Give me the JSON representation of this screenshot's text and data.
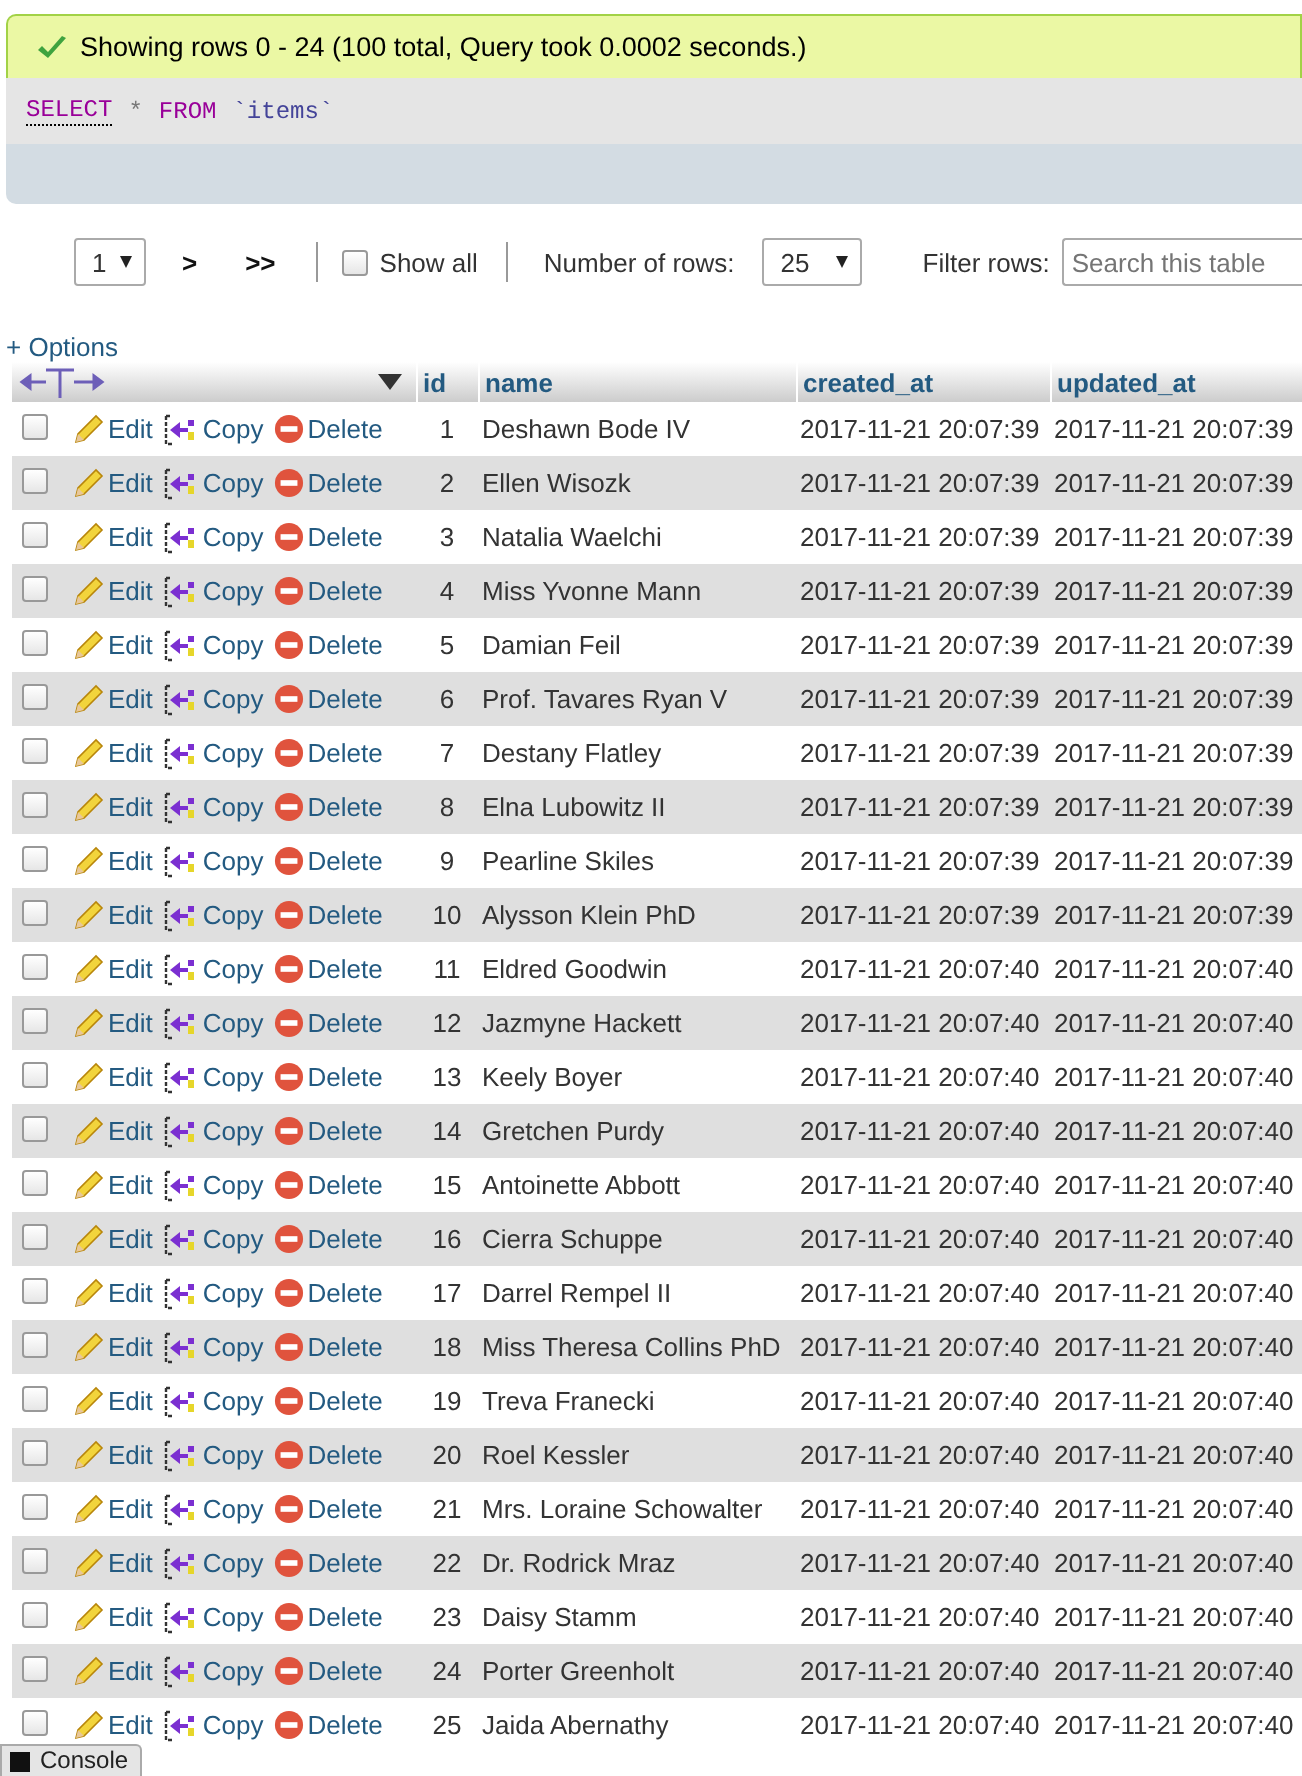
{
  "message": {
    "text": "Showing rows 0 - 24 (100 total, Query took 0.0002 seconds.)"
  },
  "sql": [
    {
      "kind": "keyword",
      "text": "SELECT",
      "link": true
    },
    {
      "kind": "operator",
      "text": "*",
      "link": false
    },
    {
      "kind": "keyword",
      "text": "FROM",
      "link": false
    },
    {
      "kind": "identifier",
      "text": "`items`",
      "link": false
    }
  ],
  "navigation": {
    "page": "1",
    "next": ">",
    "last": ">>",
    "show_all": {
      "label": "Show all",
      "checked": false
    },
    "rows_label": "Number of rows:",
    "rows_value": "25",
    "filter_label": "Filter rows:",
    "filter_placeholder": "Search this table"
  },
  "options_link": "+ Options",
  "columns": [
    "id",
    "name",
    "created_at",
    "updated_at"
  ],
  "rows": [
    {
      "checked": false,
      "edit": "Edit",
      "copy": "Copy",
      "delete": "Delete",
      "id": "1",
      "name": "Deshawn Bode IV",
      "created_at": "2017-11-21 20:07:39",
      "updated_at": "2017-11-21 20:07:39"
    },
    {
      "checked": false,
      "edit": "Edit",
      "copy": "Copy",
      "delete": "Delete",
      "id": "2",
      "name": "Ellen Wisozk",
      "created_at": "2017-11-21 20:07:39",
      "updated_at": "2017-11-21 20:07:39"
    },
    {
      "checked": false,
      "edit": "Edit",
      "copy": "Copy",
      "delete": "Delete",
      "id": "3",
      "name": "Natalia Waelchi",
      "created_at": "2017-11-21 20:07:39",
      "updated_at": "2017-11-21 20:07:39"
    },
    {
      "checked": false,
      "edit": "Edit",
      "copy": "Copy",
      "delete": "Delete",
      "id": "4",
      "name": "Miss Yvonne Mann",
      "created_at": "2017-11-21 20:07:39",
      "updated_at": "2017-11-21 20:07:39"
    },
    {
      "checked": false,
      "edit": "Edit",
      "copy": "Copy",
      "delete": "Delete",
      "id": "5",
      "name": "Damian Feil",
      "created_at": "2017-11-21 20:07:39",
      "updated_at": "2017-11-21 20:07:39"
    },
    {
      "checked": false,
      "edit": "Edit",
      "copy": "Copy",
      "delete": "Delete",
      "id": "6",
      "name": "Prof. Tavares Ryan V",
      "created_at": "2017-11-21 20:07:39",
      "updated_at": "2017-11-21 20:07:39"
    },
    {
      "checked": false,
      "edit": "Edit",
      "copy": "Copy",
      "delete": "Delete",
      "id": "7",
      "name": "Destany Flatley",
      "created_at": "2017-11-21 20:07:39",
      "updated_at": "2017-11-21 20:07:39"
    },
    {
      "checked": false,
      "edit": "Edit",
      "copy": "Copy",
      "delete": "Delete",
      "id": "8",
      "name": "Elna Lubowitz II",
      "created_at": "2017-11-21 20:07:39",
      "updated_at": "2017-11-21 20:07:39"
    },
    {
      "checked": false,
      "edit": "Edit",
      "copy": "Copy",
      "delete": "Delete",
      "id": "9",
      "name": "Pearline Skiles",
      "created_at": "2017-11-21 20:07:39",
      "updated_at": "2017-11-21 20:07:39"
    },
    {
      "checked": false,
      "edit": "Edit",
      "copy": "Copy",
      "delete": "Delete",
      "id": "10",
      "name": "Alysson Klein PhD",
      "created_at": "2017-11-21 20:07:39",
      "updated_at": "2017-11-21 20:07:39"
    },
    {
      "checked": false,
      "edit": "Edit",
      "copy": "Copy",
      "delete": "Delete",
      "id": "11",
      "name": "Eldred Goodwin",
      "created_at": "2017-11-21 20:07:40",
      "updated_at": "2017-11-21 20:07:40"
    },
    {
      "checked": false,
      "edit": "Edit",
      "copy": "Copy",
      "delete": "Delete",
      "id": "12",
      "name": "Jazmyne Hackett",
      "created_at": "2017-11-21 20:07:40",
      "updated_at": "2017-11-21 20:07:40"
    },
    {
      "checked": false,
      "edit": "Edit",
      "copy": "Copy",
      "delete": "Delete",
      "id": "13",
      "name": "Keely Boyer",
      "created_at": "2017-11-21 20:07:40",
      "updated_at": "2017-11-21 20:07:40"
    },
    {
      "checked": false,
      "edit": "Edit",
      "copy": "Copy",
      "delete": "Delete",
      "id": "14",
      "name": "Gretchen Purdy",
      "created_at": "2017-11-21 20:07:40",
      "updated_at": "2017-11-21 20:07:40"
    },
    {
      "checked": false,
      "edit": "Edit",
      "copy": "Copy",
      "delete": "Delete",
      "id": "15",
      "name": "Antoinette Abbott",
      "created_at": "2017-11-21 20:07:40",
      "updated_at": "2017-11-21 20:07:40"
    },
    {
      "checked": false,
      "edit": "Edit",
      "copy": "Copy",
      "delete": "Delete",
      "id": "16",
      "name": "Cierra Schuppe",
      "created_at": "2017-11-21 20:07:40",
      "updated_at": "2017-11-21 20:07:40"
    },
    {
      "checked": false,
      "edit": "Edit",
      "copy": "Copy",
      "delete": "Delete",
      "id": "17",
      "name": "Darrel Rempel II",
      "created_at": "2017-11-21 20:07:40",
      "updated_at": "2017-11-21 20:07:40"
    },
    {
      "checked": false,
      "edit": "Edit",
      "copy": "Copy",
      "delete": "Delete",
      "id": "18",
      "name": "Miss Theresa Collins PhD",
      "created_at": "2017-11-21 20:07:40",
      "updated_at": "2017-11-21 20:07:40"
    },
    {
      "checked": false,
      "edit": "Edit",
      "copy": "Copy",
      "delete": "Delete",
      "id": "19",
      "name": "Treva Franecki",
      "created_at": "2017-11-21 20:07:40",
      "updated_at": "2017-11-21 20:07:40"
    },
    {
      "checked": false,
      "edit": "Edit",
      "copy": "Copy",
      "delete": "Delete",
      "id": "20",
      "name": "Roel Kessler",
      "created_at": "2017-11-21 20:07:40",
      "updated_at": "2017-11-21 20:07:40"
    },
    {
      "checked": false,
      "edit": "Edit",
      "copy": "Copy",
      "delete": "Delete",
      "id": "21",
      "name": "Mrs. Loraine Schowalter",
      "created_at": "2017-11-21 20:07:40",
      "updated_at": "2017-11-21 20:07:40"
    },
    {
      "checked": false,
      "edit": "Edit",
      "copy": "Copy",
      "delete": "Delete",
      "id": "22",
      "name": "Dr. Rodrick Mraz",
      "created_at": "2017-11-21 20:07:40",
      "updated_at": "2017-11-21 20:07:40"
    },
    {
      "checked": false,
      "edit": "Edit",
      "copy": "Copy",
      "delete": "Delete",
      "id": "23",
      "name": "Daisy Stamm",
      "created_at": "2017-11-21 20:07:40",
      "updated_at": "2017-11-21 20:07:40"
    },
    {
      "checked": false,
      "edit": "Edit",
      "copy": "Copy",
      "delete": "Delete",
      "id": "24",
      "name": "Porter Greenholt",
      "created_at": "2017-11-21 20:07:40",
      "updated_at": "2017-11-21 20:07:40"
    },
    {
      "checked": false,
      "edit": "Edit",
      "copy": "Copy",
      "delete": "Delete",
      "id": "25",
      "name": "Jaida Abernathy",
      "created_at": "2017-11-21 20:07:40",
      "updated_at": "2017-11-21 20:07:40"
    }
  ],
  "console": {
    "label": "Console"
  }
}
